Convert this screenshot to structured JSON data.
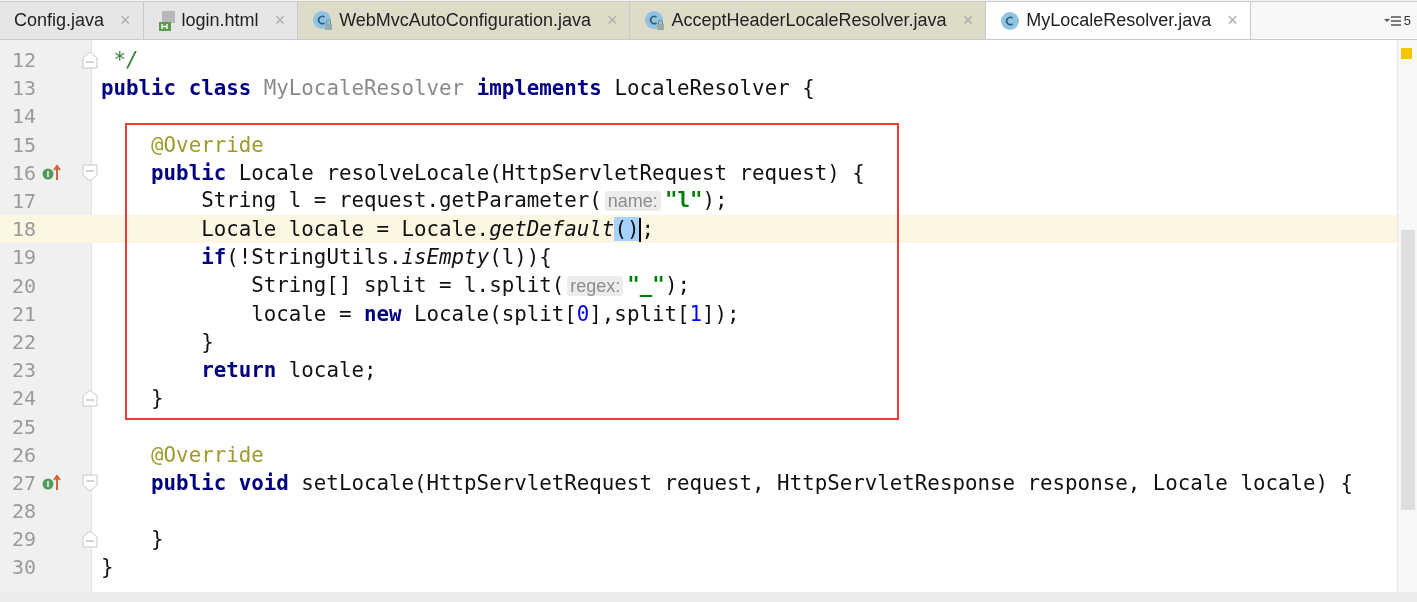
{
  "tabs": [
    {
      "label": "Config.java",
      "kind": "plain",
      "library": false,
      "selected": false,
      "close": "×"
    },
    {
      "label": "login.html",
      "kind": "html",
      "library": false,
      "selected": false,
      "close": "×"
    },
    {
      "label": "WebMvcAutoConfiguration.java",
      "kind": "class",
      "library": true,
      "selected": false,
      "close": "×"
    },
    {
      "label": "AcceptHeaderLocaleResolver.java",
      "kind": "class",
      "library": true,
      "selected": false,
      "close": "×"
    },
    {
      "label": "MyLocaleResolver.java",
      "kind": "class",
      "library": false,
      "selected": true,
      "close": "×"
    }
  ],
  "tab_overflow": {
    "count": "5"
  },
  "blocks": [
    {
      "boxed": false,
      "lines": [
        {
          "number": "12",
          "fold_start": false,
          "fold_end": true,
          "override": false,
          "current": false,
          "tokens": [
            {
              "kind": "comment",
              "t": " */"
            }
          ]
        },
        {
          "number": "13",
          "fold_start": false,
          "fold_end": false,
          "override": false,
          "current": false,
          "tokens": [
            {
              "kind": "keyword",
              "t": "public class "
            },
            {
              "kind": "unused",
              "t": "MyLocaleResolver"
            },
            {
              "kind": "keyword",
              "t": " implements"
            },
            {
              "kind": "plain",
              "t": " LocaleResolver {"
            }
          ]
        },
        {
          "number": "14",
          "fold_start": false,
          "fold_end": false,
          "override": false,
          "current": false
        }
      ]
    },
    {
      "boxed": true,
      "lines": [
        {
          "number": "15",
          "fold_start": false,
          "fold_end": false,
          "override": false,
          "current": false,
          "tokens": [
            {
              "kind": "annotation",
              "t": "    @Override"
            }
          ]
        },
        {
          "number": "16",
          "fold_start": true,
          "fold_end": false,
          "override": true,
          "current": false,
          "tokens": [
            {
              "kind": "keyword",
              "t": "    public"
            },
            {
              "kind": "plain",
              "t": " Locale resolveLocale(HttpServletRequest request) {"
            }
          ]
        },
        {
          "number": "17",
          "fold_start": false,
          "fold_end": false,
          "override": false,
          "current": false,
          "tokens": [
            {
              "kind": "plain",
              "t": "        String l = request.getParameter("
            },
            {
              "kind": "hint",
              "t": "name:"
            },
            {
              "kind": "string",
              "t": "\"l\""
            },
            {
              "kind": "plain",
              "t": ");"
            }
          ]
        },
        {
          "number": "18",
          "fold_start": false,
          "fold_end": false,
          "override": false,
          "current": true,
          "tokens": [
            {
              "kind": "plain",
              "t": "        Locale locale = Locale."
            },
            {
              "kind": "italic",
              "t": "getDefault"
            },
            {
              "kind": "plain",
              "t": "()",
              "selected": true,
              "caret": true
            },
            {
              "kind": "plain",
              "t": ";"
            }
          ]
        },
        {
          "number": "19",
          "fold_start": false,
          "fold_end": false,
          "override": false,
          "current": false,
          "tokens": [
            {
              "kind": "keyword",
              "t": "        if"
            },
            {
              "kind": "plain",
              "t": "(!StringUtils."
            },
            {
              "kind": "italic",
              "t": "isEmpty"
            },
            {
              "kind": "plain",
              "t": "(l)){"
            }
          ]
        },
        {
          "number": "20",
          "fold_start": false,
          "fold_end": false,
          "override": false,
          "current": false,
          "tokens": [
            {
              "kind": "plain",
              "t": "            String[] split = l.split("
            },
            {
              "kind": "hint",
              "t": "regex:"
            },
            {
              "kind": "string",
              "t": "\"_\""
            },
            {
              "kind": "plain",
              "t": ");"
            }
          ]
        },
        {
          "number": "21",
          "fold_start": false,
          "fold_end": false,
          "override": false,
          "current": false,
          "tokens": [
            {
              "kind": "plain",
              "t": "            locale = "
            },
            {
              "kind": "keyword",
              "t": "new"
            },
            {
              "kind": "plain",
              "t": " Locale(split["
            },
            {
              "kind": "number",
              "t": "0"
            },
            {
              "kind": "plain",
              "t": "],split["
            },
            {
              "kind": "number",
              "t": "1"
            },
            {
              "kind": "plain",
              "t": "]);"
            }
          ]
        },
        {
          "number": "22",
          "fold_start": false,
          "fold_end": false,
          "override": false,
          "current": false,
          "tokens": [
            {
              "kind": "plain",
              "t": "        }"
            }
          ]
        },
        {
          "number": "23",
          "fold_start": false,
          "fold_end": false,
          "override": false,
          "current": false,
          "tokens": [
            {
              "kind": "keyword",
              "t": "        return"
            },
            {
              "kind": "plain",
              "t": " locale;"
            }
          ]
        },
        {
          "number": "24",
          "fold_start": false,
          "fold_end": true,
          "override": false,
          "current": false,
          "tokens": [
            {
              "kind": "plain",
              "t": "    }"
            }
          ]
        }
      ]
    },
    {
      "boxed": false,
      "lines": [
        {
          "number": "25",
          "fold_start": false,
          "fold_end": false,
          "override": false,
          "current": false
        },
        {
          "number": "26",
          "fold_start": false,
          "fold_end": false,
          "override": false,
          "current": false,
          "tokens": [
            {
              "kind": "annotation",
              "t": "    @Override"
            }
          ]
        },
        {
          "number": "27",
          "fold_start": true,
          "fold_end": false,
          "override": true,
          "current": false,
          "tokens": [
            {
              "kind": "keyword",
              "t": "    public void"
            },
            {
              "kind": "plain",
              "t": " setLocale(HttpServletRequest request, HttpServletResponse response, Locale locale) {"
            }
          ]
        },
        {
          "number": "28",
          "fold_start": false,
          "fold_end": false,
          "override": false,
          "current": false
        },
        {
          "number": "29",
          "fold_start": false,
          "fold_end": true,
          "override": false,
          "current": false,
          "tokens": [
            {
              "kind": "plain",
              "t": "    }"
            }
          ]
        },
        {
          "number": "30",
          "fold_start": false,
          "fold_end": false,
          "override": false,
          "current": false,
          "tokens": [
            {
              "kind": "plain",
              "t": "}"
            }
          ]
        }
      ]
    }
  ]
}
